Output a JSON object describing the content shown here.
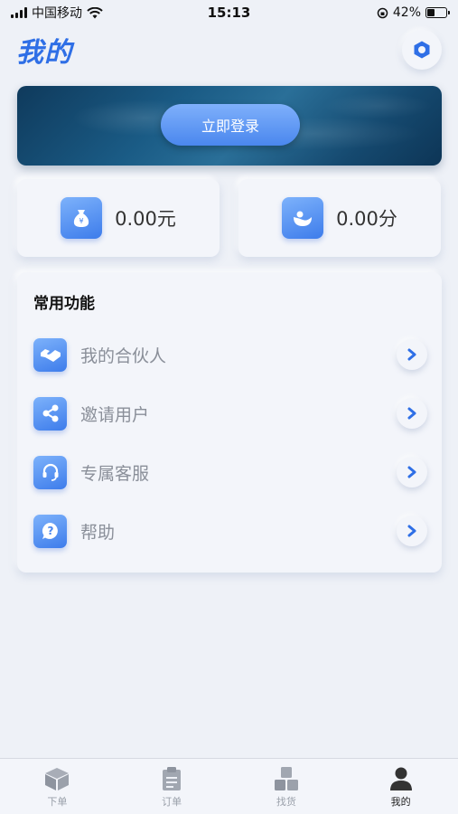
{
  "status_bar": {
    "carrier": "中国移动",
    "time": "15:13",
    "battery": "42%",
    "battery_level": 0.42
  },
  "header": {
    "title": "我的",
    "settings_icon": "gear-icon"
  },
  "login": {
    "button_label": "立即登录"
  },
  "balances": [
    {
      "icon": "money-bag-icon",
      "value": "0.00元"
    },
    {
      "icon": "points-icon",
      "value": "0.00分"
    }
  ],
  "functions": {
    "title": "常用功能",
    "items": [
      {
        "icon": "handshake-icon",
        "label": "我的合伙人"
      },
      {
        "icon": "share-icon",
        "label": "邀请用户"
      },
      {
        "icon": "headset-icon",
        "label": "专属客服"
      },
      {
        "icon": "help-icon",
        "label": "帮助"
      }
    ]
  },
  "tabs": [
    {
      "icon": "box-icon",
      "label": "下单",
      "active": false
    },
    {
      "icon": "clipboard-icon",
      "label": "订单",
      "active": false
    },
    {
      "icon": "goods-icon",
      "label": "找货",
      "active": false
    },
    {
      "icon": "user-icon",
      "label": "我的",
      "active": true
    }
  ],
  "colors": {
    "accent": "#2f6fe6",
    "background": "#eef1f7"
  }
}
